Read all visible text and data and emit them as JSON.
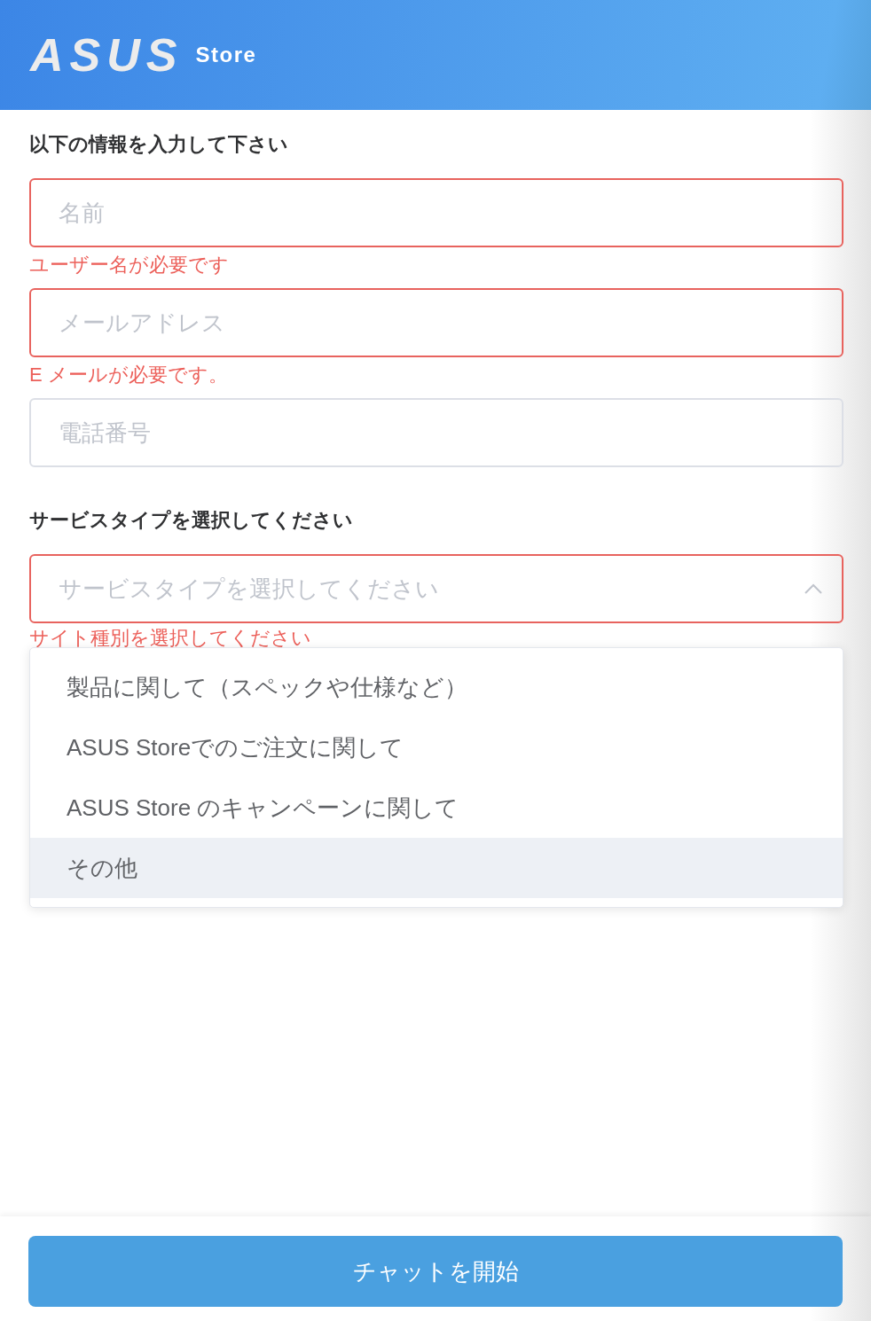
{
  "header": {
    "logo": "ASUS",
    "store_label": "Store"
  },
  "form": {
    "heading": "以下の情報を入力して下さい",
    "fields": [
      {
        "placeholder": "名前",
        "invalid": true,
        "error": "ユーザー名が必要です"
      },
      {
        "placeholder": "メールアドレス",
        "invalid": true,
        "error": "E メールが必要です。"
      },
      {
        "placeholder": "電話番号",
        "invalid": false
      }
    ]
  },
  "service": {
    "heading": "サービスタイプを選択してください",
    "select": {
      "placeholder": "サービスタイプを選択してください",
      "invalid": true,
      "expanded": true,
      "error": "サイト種別を選択してください"
    },
    "options": [
      {
        "label": "製品に関して（スペックや仕様など）",
        "highlighted": false
      },
      {
        "label": "ASUS Storeでのご注文に関して",
        "highlighted": false
      },
      {
        "label": "ASUS Store のキャンペーンに関して",
        "highlighted": false
      },
      {
        "label": "その他",
        "highlighted": true
      }
    ]
  },
  "start_button": "チャットを開始"
}
